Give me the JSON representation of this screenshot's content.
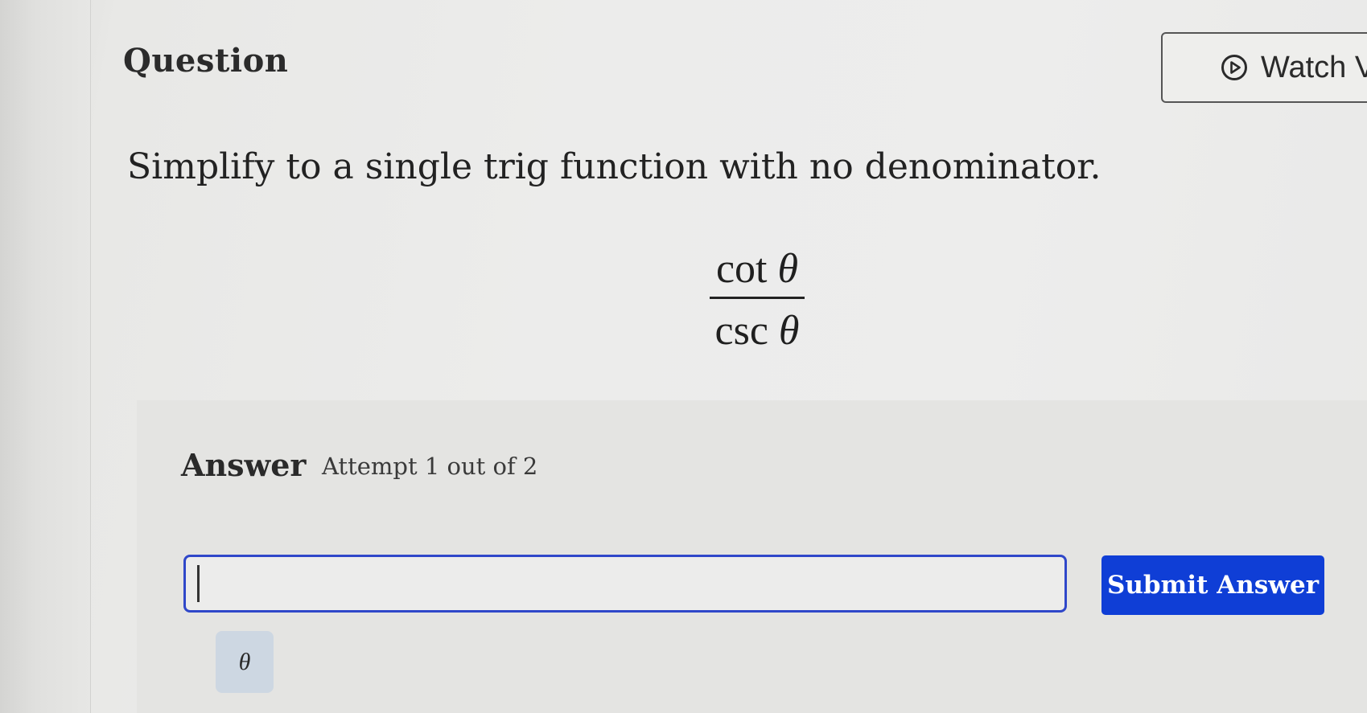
{
  "header": {
    "title": "Question",
    "watch_button_label": "Watch V"
  },
  "question": {
    "prompt": "Simplify to a single trig function with no denominator.",
    "numerator_func": "cot",
    "numerator_var": "θ",
    "denominator_func": "csc",
    "denominator_var": "θ"
  },
  "answer": {
    "label": "Answer",
    "attempt": "Attempt 1 out of 2",
    "input_value": "",
    "submit_label": "Submit Answer",
    "symbol_key": "θ"
  },
  "colors": {
    "submit_bg": "#0f3ed6",
    "input_border": "#2f47c9",
    "symbol_key_bg": "#cdd7e2"
  }
}
